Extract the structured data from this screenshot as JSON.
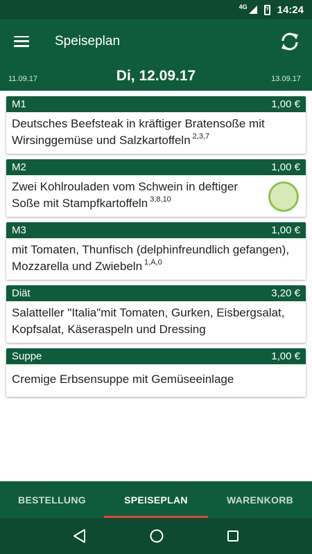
{
  "status_bar": {
    "network": "4G",
    "time": "14:24"
  },
  "app_bar": {
    "title": "Speiseplan"
  },
  "date_bar": {
    "previous": "11.09.17",
    "current": "Di, 12.09.17",
    "next": "13.09.17"
  },
  "menu": [
    {
      "name": "M1",
      "price": "1,00 €",
      "description": "Deutsches Beefsteak in kräftiger Bratensoße mit Wirsinggemüse und Salzkartoffeln",
      "additives": "2,3,7",
      "selected": false
    },
    {
      "name": "M2",
      "price": "1,00 €",
      "description": "Zwei Kohlrouladen vom Schwein in deftiger Soße mit Stampfkartoffeln",
      "additives": "3,8,10",
      "selected": true
    },
    {
      "name": "M3",
      "price": "1,00 €",
      "description": "mit Tomaten, Thunfisch (delphinfreundlich gefangen), Mozzarella und Zwiebeln",
      "additives": "1,A,0",
      "selected": false
    },
    {
      "name": "Diät",
      "price": "3,20 €",
      "description": "Salatteller \"Italia\"mit Tomaten, Gurken, Eisbergsalat, Kopfsalat, Käseraspeln und Dressing",
      "additives": "",
      "selected": false
    },
    {
      "name": "Suppe",
      "price": "1,00 €",
      "description": "Cremige Erbsensuppe mit Gemüseeinlage",
      "additives": "",
      "selected": false
    }
  ],
  "bottom_nav": {
    "tabs": [
      "BESTELLUNG",
      "SPEISEPLAN",
      "WARENKORB"
    ],
    "active": "SPEISEPLAN"
  },
  "colors": {
    "primary": "#0f5c3c",
    "status_bar": "#0e4a30",
    "accent_indicator": "#e3453a",
    "selected_fill": "#d7e9b9",
    "selected_border": "#8bc34a"
  },
  "icons": [
    "menu-icon",
    "sync-icon",
    "back-icon",
    "home-icon",
    "recents-icon"
  ]
}
